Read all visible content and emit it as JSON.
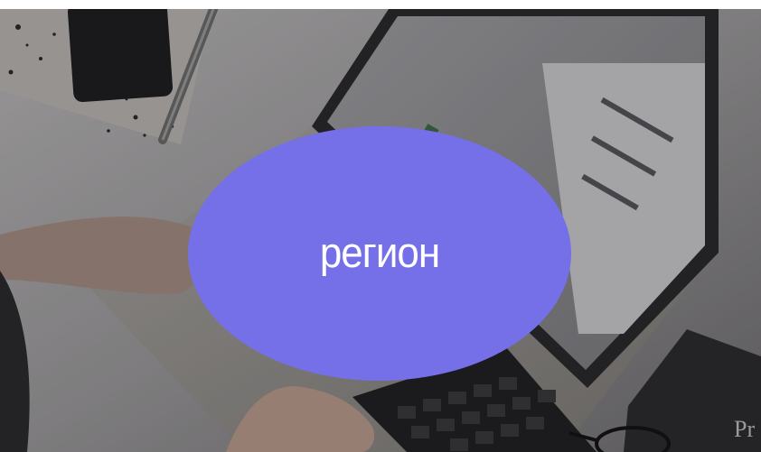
{
  "card": {
    "label": "регион",
    "accent_color": "#7570e8"
  },
  "photo": {
    "visible_fragment_text": "Pr",
    "icons": [
      "notebook",
      "phone",
      "pen",
      "laptop",
      "keyboard",
      "hands",
      "book",
      "eyeglasses"
    ]
  }
}
